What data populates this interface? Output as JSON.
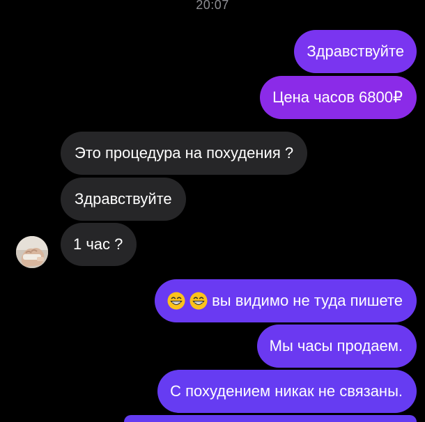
{
  "status": {
    "time": "20:07"
  },
  "conversation": {
    "messages": [
      {
        "direction": "outgoing",
        "text": "Здравствуйте"
      },
      {
        "direction": "outgoing",
        "text": "Цена часов 6800₽"
      },
      {
        "direction": "incoming",
        "text": "Это процедура на похудения ?"
      },
      {
        "direction": "incoming",
        "text": "Здравствуйте"
      },
      {
        "direction": "incoming",
        "text": "1 час ?"
      },
      {
        "direction": "outgoing",
        "emoji": [
          "grinning-face-with-smiling-eyes",
          "grinning-face-with-smiling-eyes"
        ],
        "text": "вы видимо не туда пишете"
      },
      {
        "direction": "outgoing",
        "text": "Мы часы продаем."
      },
      {
        "direction": "outgoing",
        "text": "С похудением никак не связаны."
      }
    ]
  },
  "colors": {
    "background": "#000000",
    "outgoing_bubble": "#7a35f0",
    "incoming_bubble": "#262628",
    "timestamp": "#8e8e93",
    "text": "#ffffff"
  },
  "icons": {
    "avatar": "contact-avatar",
    "emoji": "grinning-face-with-smiling-eyes"
  }
}
